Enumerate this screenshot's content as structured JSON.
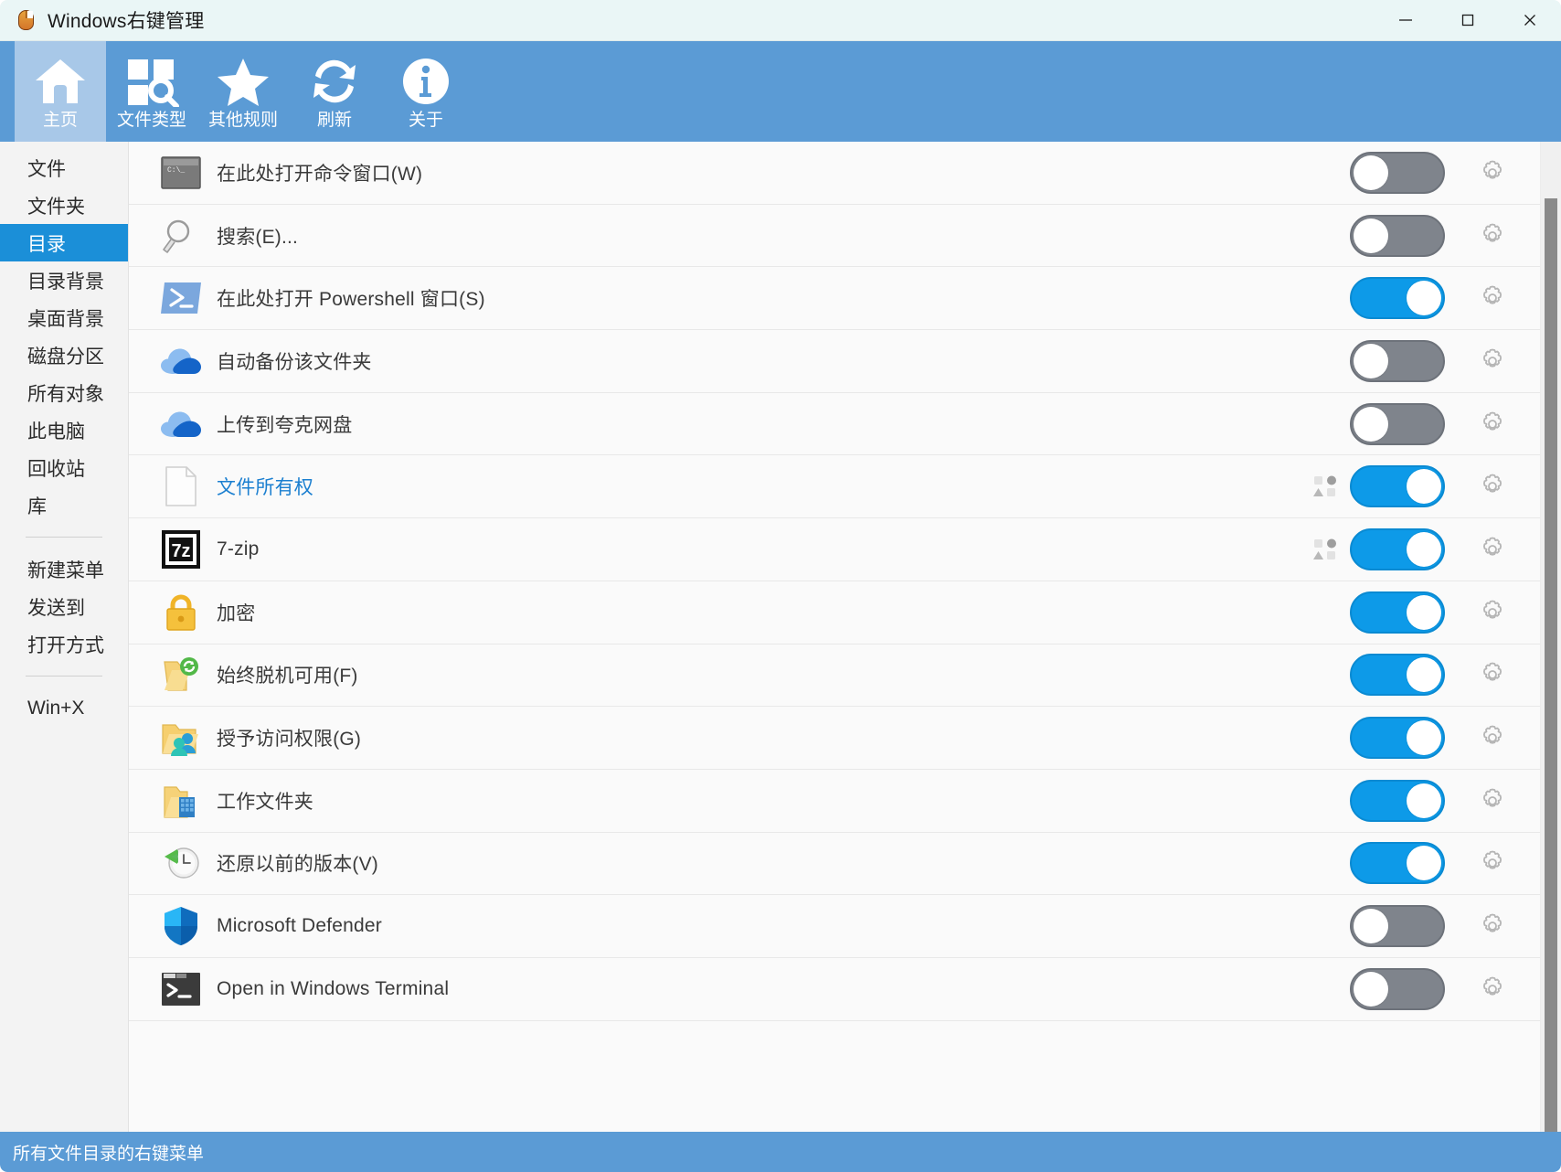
{
  "window": {
    "title": "Windows右键管理",
    "app_icon": "mouse-icon",
    "controls": {
      "minimize": "minimize-icon",
      "maximize": "maximize-icon",
      "close": "close-icon"
    }
  },
  "ribbon": {
    "items": [
      {
        "label": "主页",
        "icon": "home-icon",
        "active": true
      },
      {
        "label": "文件类型",
        "icon": "filetype-search-icon",
        "active": false
      },
      {
        "label": "其他规则",
        "icon": "star-icon",
        "active": false
      },
      {
        "label": "刷新",
        "icon": "refresh-icon",
        "active": false
      },
      {
        "label": "关于",
        "icon": "info-icon",
        "active": false
      }
    ]
  },
  "sidebar": {
    "groups": [
      {
        "items": [
          {
            "label": "文件",
            "active": false
          },
          {
            "label": "文件夹",
            "active": false
          },
          {
            "label": "目录",
            "active": true
          },
          {
            "label": "目录背景",
            "active": false
          },
          {
            "label": "桌面背景",
            "active": false
          },
          {
            "label": "磁盘分区",
            "active": false
          },
          {
            "label": "所有对象",
            "active": false
          },
          {
            "label": "此电脑",
            "active": false
          },
          {
            "label": "回收站",
            "active": false
          },
          {
            "label": "库",
            "active": false
          }
        ]
      },
      {
        "items": [
          {
            "label": "新建菜单",
            "active": false
          },
          {
            "label": "发送到",
            "active": false
          },
          {
            "label": "打开方式",
            "active": false
          }
        ]
      },
      {
        "items": [
          {
            "label": "Win+X",
            "active": false
          }
        ]
      }
    ]
  },
  "list": {
    "rows": [
      {
        "label": "在此处打开命令窗口(W)",
        "accel": "W",
        "icon": "cmd-icon",
        "enabled": false,
        "link": false,
        "submenu": false
      },
      {
        "label": "搜索(E)...",
        "accel": "E",
        "icon": "magnifier-icon",
        "enabled": false,
        "link": false,
        "submenu": false
      },
      {
        "label": "在此处打开 Powershell 窗口(S)",
        "accel": "S",
        "icon": "powershell-icon",
        "enabled": true,
        "link": false,
        "submenu": false
      },
      {
        "label": "自动备份该文件夹",
        "accel": "",
        "icon": "onedrive-icon",
        "enabled": false,
        "link": false,
        "submenu": false
      },
      {
        "label": "上传到夸克网盘",
        "accel": "",
        "icon": "onedrive-icon",
        "enabled": false,
        "link": false,
        "submenu": false
      },
      {
        "label": "文件所有权",
        "accel": "",
        "icon": "blank-page-icon",
        "enabled": true,
        "link": true,
        "submenu": true
      },
      {
        "label": "7-zip",
        "accel": "",
        "icon": "sevenzip-icon",
        "enabled": true,
        "link": false,
        "submenu": true
      },
      {
        "label": "加密",
        "accel": "",
        "icon": "lock-icon",
        "enabled": true,
        "link": false,
        "submenu": false
      },
      {
        "label": "始终脱机可用(F)",
        "accel": "F",
        "icon": "offline-folder-icon",
        "enabled": true,
        "link": false,
        "submenu": false
      },
      {
        "label": "授予访问权限(G)",
        "accel": "G",
        "icon": "share-folder-icon",
        "enabled": true,
        "link": false,
        "submenu": false
      },
      {
        "label": "工作文件夹",
        "accel": "",
        "icon": "work-folder-icon",
        "enabled": true,
        "link": false,
        "submenu": false
      },
      {
        "label": "还原以前的版本(V)",
        "accel": "V",
        "icon": "restore-clock-icon",
        "enabled": true,
        "link": false,
        "submenu": false
      },
      {
        "label": "Microsoft Defender",
        "accel": "",
        "icon": "defender-shield-icon",
        "enabled": false,
        "link": false,
        "submenu": false
      },
      {
        "label": "Open in Windows Terminal",
        "accel": "",
        "icon": "terminal-icon",
        "enabled": false,
        "link": false,
        "submenu": false
      }
    ],
    "row_settings_icon": "gear-icon",
    "submenu_icon": "shapes-icon",
    "scrollbar": "vertical-scrollbar"
  },
  "statusbar": {
    "text": "所有文件目录的右键菜单"
  },
  "colors": {
    "ribbon": "#5b9bd5",
    "ribbon_active": "#a8c8e8",
    "nav_active": "#1b8fd8",
    "toggle_on": "#0d9ae8",
    "toggle_off": "#7f848c",
    "link": "#1b7fd0",
    "titlebar": "#eaf6f6",
    "statusbar": "#5b9bd5"
  }
}
